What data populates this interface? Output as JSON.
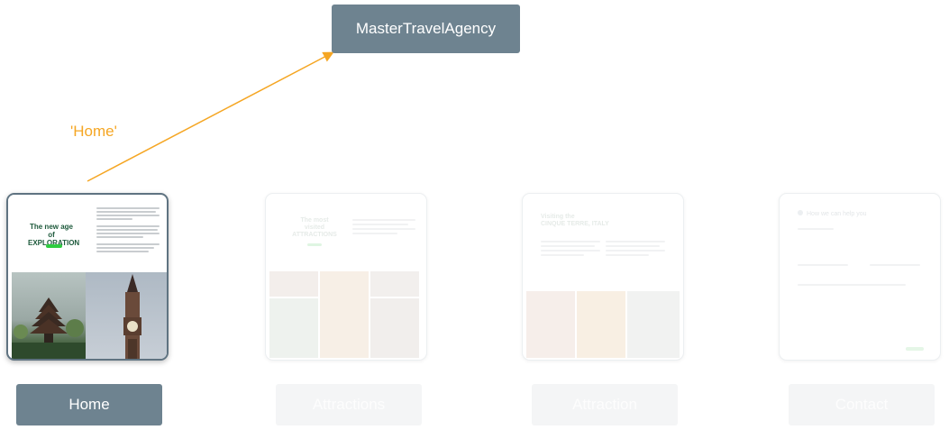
{
  "root": {
    "label": "MasterTravelAgency"
  },
  "edge": {
    "label": "'Home'",
    "color": "#f5a623"
  },
  "colors": {
    "node_bg": "#6e8390",
    "accent_green": "#2ecc40",
    "heading_green": "#1e5a3c"
  },
  "home_preview": {
    "headline_line1": "The new age of",
    "headline_line2": "EXPLORATION"
  },
  "attractions_preview": {
    "headline_line1": "The most",
    "headline_line2": "visited",
    "headline_line3": "ATTRACTIONS"
  },
  "attraction_preview": {
    "headline_line1": "Visiting the",
    "headline_line2": "CINQUE TERRE, ITALY"
  },
  "contact_preview": {
    "heading": "How we can help you"
  },
  "pages": [
    {
      "label": "Home",
      "state": "active"
    },
    {
      "label": "Attractions",
      "state": "inactive"
    },
    {
      "label": "Attraction",
      "state": "inactive"
    },
    {
      "label": "Contact",
      "state": "inactive"
    }
  ]
}
